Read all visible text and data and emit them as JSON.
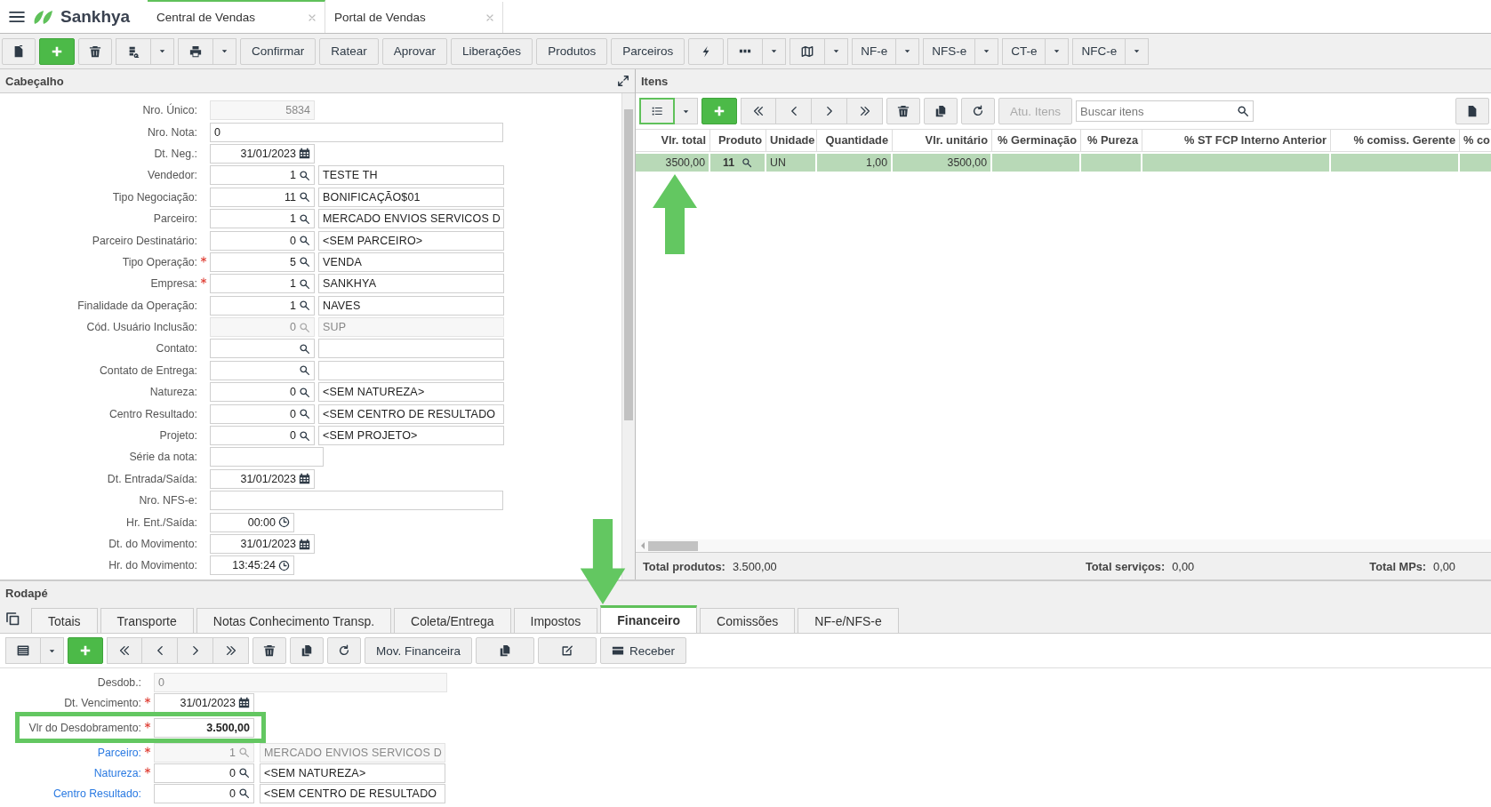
{
  "app": {
    "brand": "Sankhya",
    "tabs": [
      {
        "label": "Central de Vendas",
        "selected": true
      },
      {
        "label": "Portal de Vendas",
        "selected": false
      }
    ]
  },
  "toolbar": {
    "actions": [
      "Confirmar",
      "Ratear",
      "Aprovar",
      "Liberações",
      "Produtos",
      "Parceiros"
    ],
    "documents": [
      "NF-e",
      "NFS-e",
      "CT-e",
      "NFC-e"
    ]
  },
  "header_panel": {
    "title": "Cabeçalho",
    "fields": [
      {
        "label": "Nro. Único:",
        "kind": "number",
        "required": false,
        "disabled": true,
        "value": "5834"
      },
      {
        "label": "Nro. Nota:",
        "kind": "text",
        "required": false,
        "disabled": false,
        "value": "0"
      },
      {
        "label": "Dt. Neg.:",
        "kind": "date",
        "required": false,
        "disabled": false,
        "value": "31/01/2023"
      },
      {
        "label": "Vendedor:",
        "kind": "lookup",
        "required": false,
        "disabled": false,
        "code": "1",
        "description": "TESTE TH"
      },
      {
        "label": "Tipo Negociação:",
        "kind": "lookup",
        "required": false,
        "disabled": false,
        "code": "11",
        "description": "BONIFICAÇÃO$01"
      },
      {
        "label": "Parceiro:",
        "kind": "lookup",
        "required": false,
        "disabled": false,
        "code": "1",
        "description": "MERCADO ENVIOS SERVICOS D"
      },
      {
        "label": "Parceiro Destinatário:",
        "kind": "lookup",
        "required": false,
        "disabled": false,
        "code": "0",
        "description": "<SEM PARCEIRO>"
      },
      {
        "label": "Tipo Operação:",
        "kind": "lookup",
        "required": true,
        "disabled": false,
        "code": "5",
        "description": "VENDA"
      },
      {
        "label": "Empresa:",
        "kind": "lookup",
        "required": true,
        "disabled": false,
        "code": "1",
        "description": "SANKHYA"
      },
      {
        "label": "Finalidade da Operação:",
        "kind": "lookup",
        "required": false,
        "disabled": false,
        "code": "1",
        "description": "NAVES"
      },
      {
        "label": "Cód. Usuário Inclusão:",
        "kind": "lookup",
        "required": false,
        "disabled": true,
        "code": "0",
        "description": "SUP"
      },
      {
        "label": "Contato:",
        "kind": "lookup",
        "required": false,
        "disabled": false
      },
      {
        "label": "Contato de Entrega:",
        "kind": "lookup",
        "required": false,
        "disabled": false
      },
      {
        "label": "Natureza:",
        "kind": "lookup",
        "required": false,
        "disabled": false,
        "code": "0",
        "description": "<SEM NATUREZA>"
      },
      {
        "label": "Centro Resultado:",
        "kind": "lookup",
        "required": false,
        "disabled": false,
        "code": "0",
        "description": "<SEM CENTRO DE RESULTADO"
      },
      {
        "label": "Projeto:",
        "kind": "lookup",
        "required": false,
        "disabled": false,
        "code": "0",
        "description": "<SEM PROJETO>"
      },
      {
        "label": "Série da nota:",
        "kind": "short",
        "required": false,
        "disabled": false
      },
      {
        "label": "Dt. Entrada/Saída:",
        "kind": "date",
        "required": false,
        "disabled": false,
        "value": "31/01/2023"
      },
      {
        "label": "Nro. NFS-e:",
        "kind": "text",
        "required": false,
        "disabled": false
      },
      {
        "label": "Hr. Ent./Saída:",
        "kind": "time",
        "required": false,
        "disabled": false,
        "value": "00:00"
      },
      {
        "label": "Dt. do Movimento:",
        "kind": "date",
        "required": false,
        "disabled": false,
        "value": "31/01/2023"
      },
      {
        "label": "Hr. do Movimento:",
        "kind": "time",
        "required": false,
        "disabled": false,
        "value": "13:45:24"
      }
    ]
  },
  "items_panel": {
    "title": "Itens",
    "refresh_button": {
      "label": "Atu. Itens",
      "disabled": true
    },
    "search": {
      "placeholder": "Buscar itens"
    },
    "columns": [
      "Vlr. total",
      "Produto",
      "Unidade",
      "Quantidade",
      "Vlr. unitário",
      "% Germinação",
      "% Pureza",
      "% ST FCP Interno Anterior",
      "% comiss. Gerente",
      "% co"
    ],
    "rows": [
      {
        "selected": true,
        "cells": [
          "3500,00",
          "11",
          "UN",
          "1,00",
          "3500,00"
        ]
      }
    ],
    "totals": [
      {
        "label": "Total produtos:",
        "value": "3.500,00"
      },
      {
        "label": "Total serviços:",
        "value": "0,00"
      },
      {
        "label": "Total MPs:",
        "value": "0,00"
      }
    ]
  },
  "footer_panel": {
    "title": "Rodapé",
    "tabs": [
      {
        "label": "Totais",
        "selected": false
      },
      {
        "label": "Transporte",
        "selected": false
      },
      {
        "label": "Notas Conhecimento Transp.",
        "selected": false
      },
      {
        "label": "Coleta/Entrega",
        "selected": false
      },
      {
        "label": "Impostos",
        "selected": false
      },
      {
        "label": "Financeiro",
        "selected": true
      },
      {
        "label": "Comissões",
        "selected": false
      },
      {
        "label": "NF-e/NFS-e",
        "selected": false
      }
    ],
    "buttons": [
      "Mov. Financeira",
      "Receber"
    ],
    "fields": [
      {
        "label": "Desdob.:",
        "kind": "text",
        "required": false,
        "disabled": true,
        "link": false,
        "highlighted": false,
        "value": "0"
      },
      {
        "label": "Dt. Vencimento:",
        "kind": "date",
        "required": true,
        "disabled": false,
        "link": false,
        "highlighted": false,
        "value": "31/01/2023"
      },
      {
        "label": "Vlr do Desdobramento:",
        "kind": "amount",
        "required": true,
        "disabled": false,
        "link": false,
        "highlighted": true,
        "value": "3.500,00"
      },
      {
        "label": "Parceiro:",
        "kind": "lookup",
        "required": true,
        "disabled": true,
        "link": true,
        "highlighted": false,
        "code": "1",
        "description": "MERCADO ENVIOS SERVICOS D"
      },
      {
        "label": "Natureza:",
        "kind": "lookup",
        "required": true,
        "disabled": false,
        "link": true,
        "highlighted": false,
        "code": "0",
        "description": "<SEM NATUREZA>"
      },
      {
        "label": "Centro Resultado:",
        "kind": "lookup",
        "required": false,
        "disabled": false,
        "link": true,
        "highlighted": false,
        "code": "0",
        "description": "<SEM CENTRO DE RESULTADO"
      }
    ]
  }
}
